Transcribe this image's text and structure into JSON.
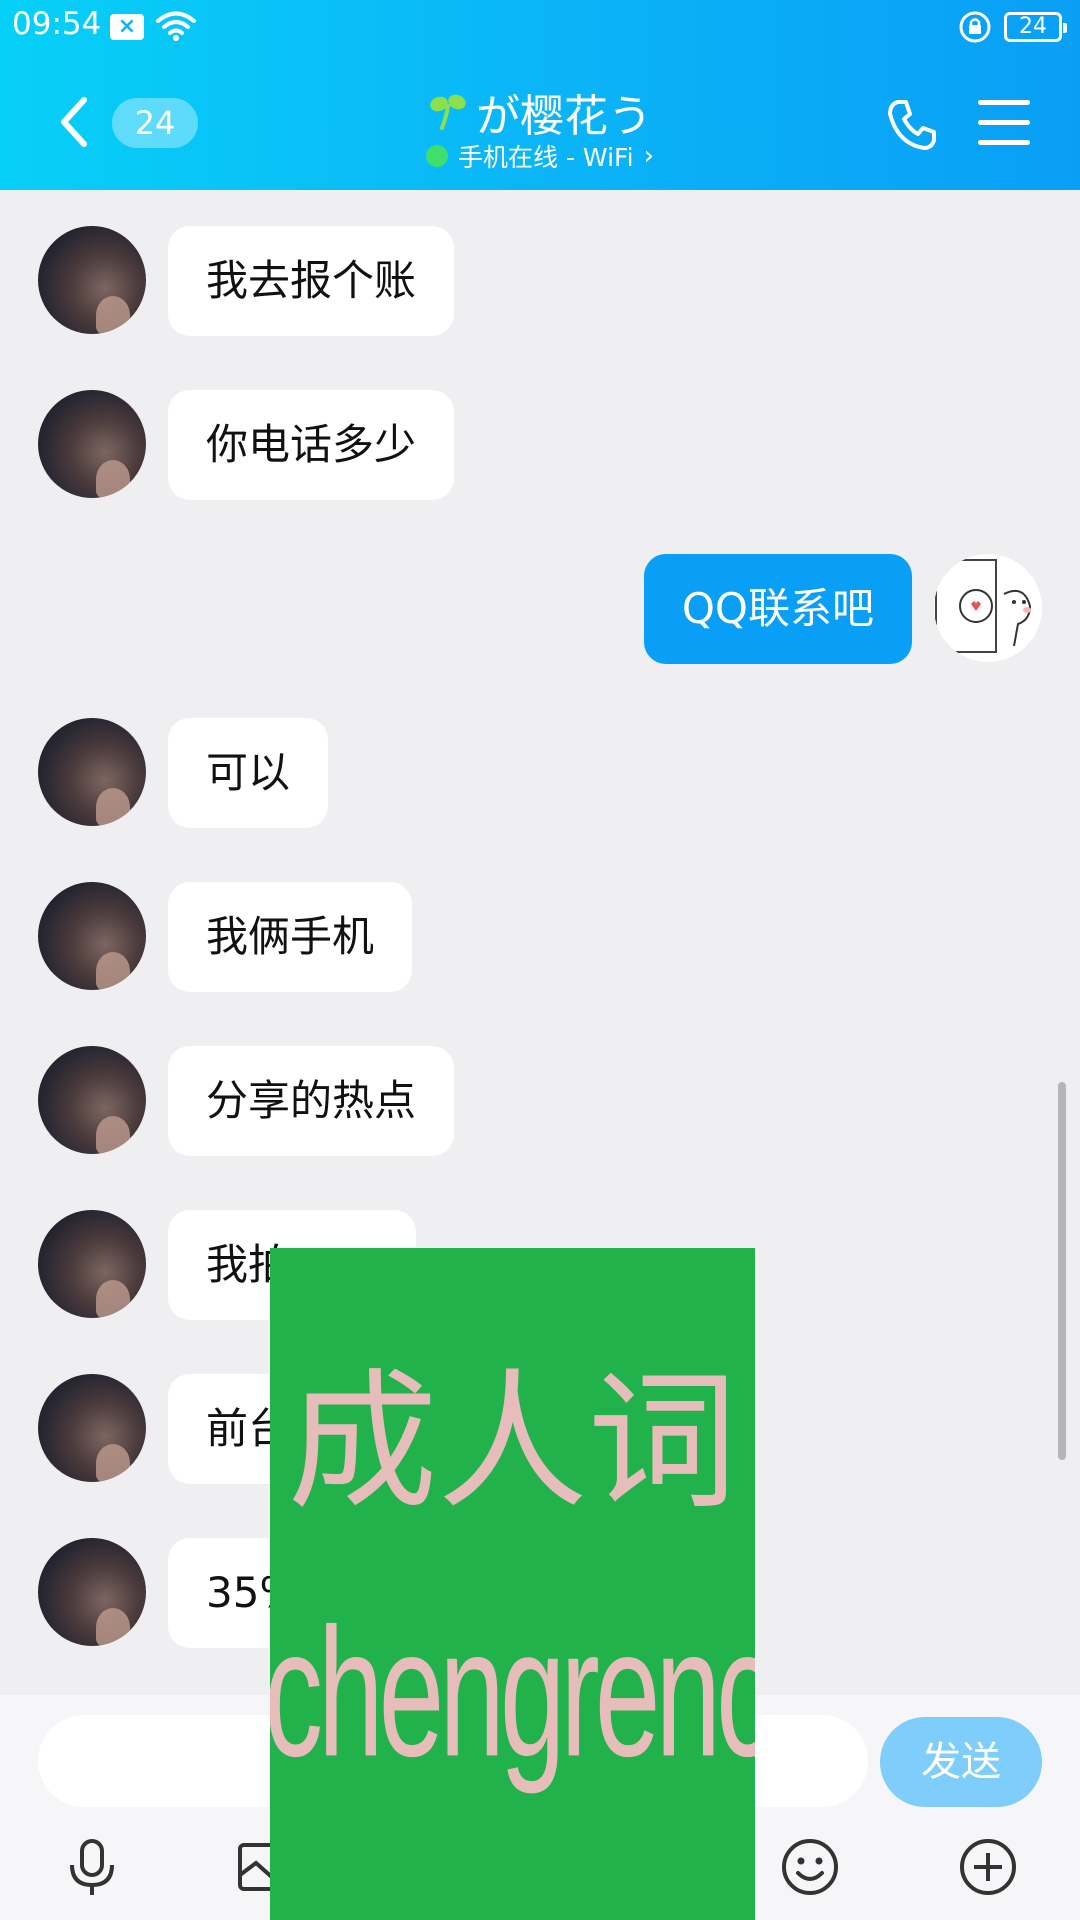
{
  "status_bar": {
    "time": "09:54",
    "battery": "24"
  },
  "header": {
    "unread_count": "24",
    "title": "が樱花う",
    "subtitle": "手机在线 - WiFi",
    "back_icon": "chevron-left-icon",
    "call_icon": "phone-icon",
    "menu_icon": "menu-icon"
  },
  "messages": [
    {
      "sender": "contact",
      "text": "我去报个账"
    },
    {
      "sender": "contact",
      "text": "你电话多少"
    },
    {
      "sender": "me",
      "text": "QQ联系吧"
    },
    {
      "sender": "contact",
      "text": "可以"
    },
    {
      "sender": "contact",
      "text": "我俩手机"
    },
    {
      "sender": "contact",
      "text": "分享的热点"
    },
    {
      "sender": "contact",
      "text": "我拍"
    },
    {
      "sender": "contact",
      "text": "前台"
    },
    {
      "sender": "contact",
      "text": "35%"
    }
  ],
  "composer": {
    "placeholder": "",
    "send_label": "发送",
    "tools": [
      "microphone-icon",
      "image-icon",
      "emoji-icon",
      "plus-icon"
    ]
  },
  "ad": {
    "text_cn": "成人词",
    "text_url": "chengrenci.com"
  },
  "colors": {
    "header_start": "#07d0f7",
    "header_end": "#099ff6",
    "outgoing_bubble": "#0a9ff6",
    "send_button": "#7fcdfa",
    "online_dot": "#3ee06b",
    "ad_background": "#22b24c"
  }
}
